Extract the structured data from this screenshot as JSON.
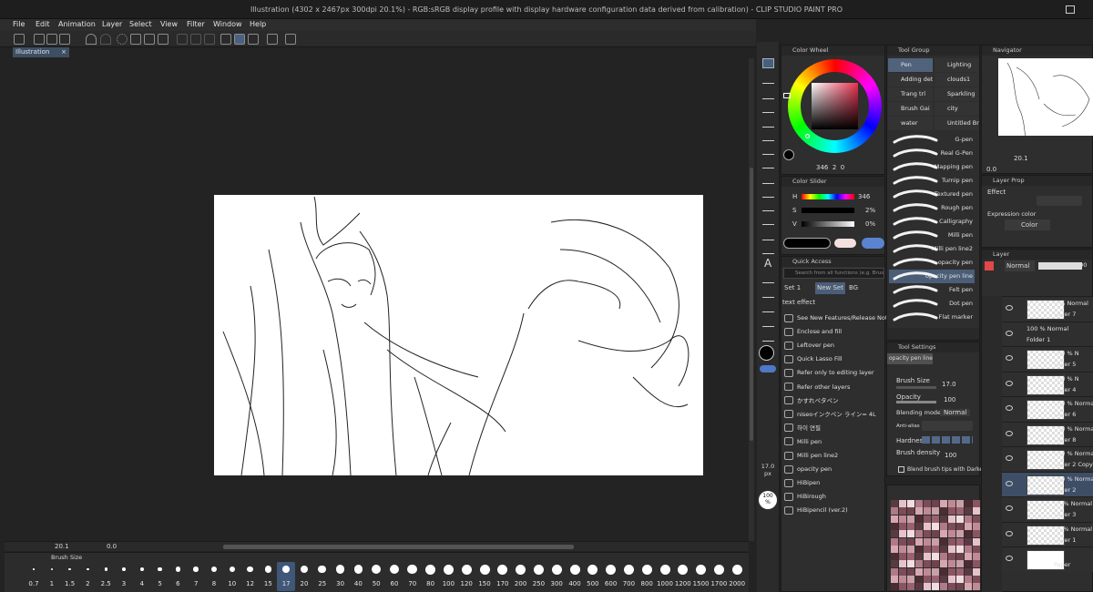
{
  "window": {
    "title": "Illustration (4302 x 2467px 300dpi 20.1%) - RGB:sRGB display profile with display hardware configuration data derived from calibration) - CLIP STUDIO PAINT PRO"
  },
  "menu": [
    "File",
    "Edit",
    "Animation",
    "Layer",
    "Select",
    "View",
    "Filter",
    "Window",
    "Help"
  ],
  "document_tab": {
    "label": "Illustration",
    "close": "×"
  },
  "navigator_bar": {
    "zoom": "20.1",
    "angle": "0.0"
  },
  "brush_size_bar": {
    "title": "Brush Size",
    "sizes": [
      "0.7",
      "1",
      "1.5",
      "2",
      "2.5",
      "3",
      "4",
      "5",
      "6",
      "7",
      "8",
      "10",
      "12",
      "15",
      "17",
      "20",
      "25",
      "30",
      "40",
      "50",
      "60",
      "70",
      "80",
      "100",
      "120",
      "150",
      "170",
      "200",
      "250",
      "300",
      "400",
      "500",
      "600",
      "700",
      "800",
      "1000",
      "1200",
      "1500",
      "1700",
      "2000"
    ],
    "selected": "17"
  },
  "toolstrip": {
    "brush_size_value": "17.0",
    "brush_size_unit": "px",
    "opacity_value": "100",
    "opacity_unit": "%"
  },
  "color_wheel": {
    "title": "Color Wheel",
    "h": "346",
    "s": "2",
    "v": "0",
    "accent": "#e8324f"
  },
  "color_slider": {
    "title": "Color Slider",
    "labels": [
      "H",
      "S",
      "V"
    ],
    "values": [
      "346",
      "2%",
      "0%"
    ]
  },
  "quick_access": {
    "title": "Quick Access",
    "search_placeholder": "Search from all functions (e.g. Brush)",
    "tabs": [
      "Set 1",
      "New Set",
      "BG"
    ],
    "subtitle": "text effect",
    "items": [
      "See New Features/Release Notes",
      "Enclose and fill",
      "Leftover pen",
      "Quick Lasso Fill",
      "Refer only to editing layer",
      "Refer other layers",
      "かすれペタペン",
      "niseoインクペン ライン= 4L",
      "하이 연필",
      "Milli pen",
      "Milli pen line2",
      "opacity pen",
      "HiBipen",
      "HiBirough",
      "HiBipencil (ver.2)"
    ]
  },
  "tool_group": {
    "title": "Tool Group",
    "items": [
      "Pen",
      "Lighting",
      "Adding deta",
      "clouds1",
      "Trang trí",
      "Sparkling",
      "Brush Gai",
      "city",
      "water",
      "Untitled Br"
    ],
    "selected": "Pen"
  },
  "sub_tool": {
    "brushes": [
      "G-pen",
      "Real G-Pen",
      "Mapping pen",
      "Turnip pen",
      "Textured pen",
      "Rough pen",
      "Calligraphy",
      "Milli pen",
      "Milli pen line2",
      "opacity pen",
      "opacity pen line",
      "Felt pen",
      "Dot pen",
      "Flat marker"
    ],
    "selected": "opacity pen line"
  },
  "tool_settings": {
    "title": "Tool Settings",
    "tool_name": "opacity pen line",
    "brush_size_label": "Brush Size",
    "brush_size": "17.0",
    "opacity_label": "Opacity",
    "opacity": "100",
    "blending_label": "Blending mode",
    "blending": "Normal",
    "antialias_label": "Anti-alias",
    "hardness_label": "Hardness",
    "density_label": "Brush density",
    "density": "100",
    "blend_tips_label": "Blend brush tips with Darken"
  },
  "navigator": {
    "title": "Navigator",
    "zoom": "20.1",
    "angle": "0.0"
  },
  "layer_property": {
    "title": "Layer Prop",
    "effect_label": "Effect",
    "expression_label": "Expression color",
    "expression_value": "Color"
  },
  "layers": {
    "title": "Layer",
    "blend": "Normal",
    "opacity": "100",
    "items": [
      {
        "mode": "0 % Normal",
        "name": "Layer 7"
      },
      {
        "mode": "100 % Normal",
        "name": "Folder 1"
      },
      {
        "mode": "100 % N",
        "name": "Layer 5"
      },
      {
        "mode": "100 % N",
        "name": "Layer 4"
      },
      {
        "mode": "100 % Normal",
        "name": "Layer 6"
      },
      {
        "mode": "100 % Normal",
        "name": "Layer 8"
      },
      {
        "mode": "100 % Normal",
        "name": "Layer 2 Copy"
      },
      {
        "mode": "100 % Normal",
        "name": "Layer 2"
      },
      {
        "mode": "27 % Normal",
        "name": "Layer 3"
      },
      {
        "mode": "20 % Normal",
        "name": "Layer 1"
      },
      {
        "mode": "",
        "name": "Paper"
      }
    ],
    "selected": "Layer 2"
  }
}
